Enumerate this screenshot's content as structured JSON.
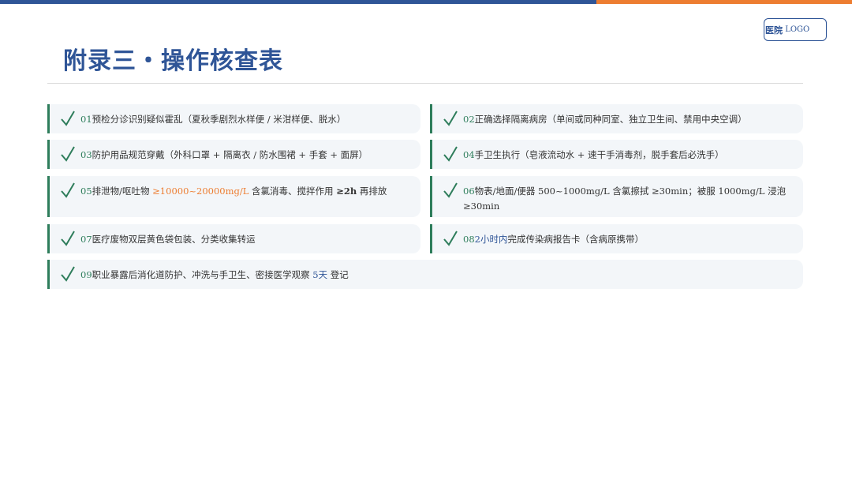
{
  "header": {
    "logo_zh": "医院",
    "logo_en": "LOGO",
    "title": "附录三・操作核查表"
  },
  "colors": {
    "primary": "#2f5597",
    "accent": "#ed7d31",
    "check": "#2e7d5b",
    "card_bg": "#f3f6f9"
  },
  "items": [
    {
      "num": "01",
      "text": "预检分诊识别疑似霍乱（夏秋季剧烈水样便 / 米泔样便、脱水）"
    },
    {
      "num": "02",
      "text": "正确选择隔离病房（单间或同种同室、独立卫生间、禁用中央空调）"
    },
    {
      "num": "03",
      "text": "防护用品规范穿戴（外科口罩 + 隔离衣 / 防水围裙 + 手套 + 面屏）"
    },
    {
      "num": "04",
      "text": "手卫生执行（皂液流动水 + 速干手消毒剂，脱手套后必洗手）"
    },
    {
      "num": "05",
      "text_a": "排泄物/呕吐物 ",
      "hl": "≥10000~20000mg/L",
      "text_b": " 含氯消毒、搅拌作用 ",
      "bold": "≥2h",
      "text_c": " 再排放"
    },
    {
      "num": "06",
      "text": "物表/地面/便器 500~1000mg/L 含氯擦拭 ≥30min；被服 1000mg/L 浸泡 ≥30min"
    },
    {
      "num": "07",
      "text": "医疗废物双层黄色袋包装、分类收集转运"
    },
    {
      "num": "08",
      "hl": "2小时内",
      "text": "完成传染病报告卡（含病原携带）"
    },
    {
      "num": "09",
      "text_a": "职业暴露后消化道防护、冲洗与手卫生、密接医学观察 ",
      "hl": "5天",
      "text_b": " 登记"
    }
  ]
}
